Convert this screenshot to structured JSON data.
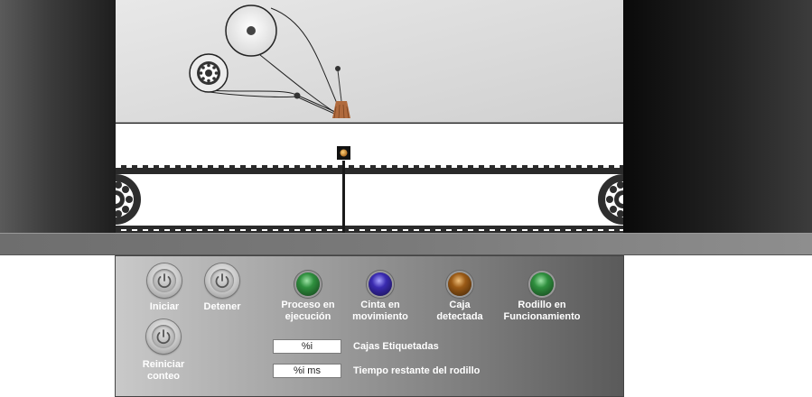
{
  "controls": {
    "start_label": "Iniciar",
    "stop_label": "Detener",
    "reset_label_line1": "Reiniciar",
    "reset_label_line2": "conteo"
  },
  "indicators": [
    {
      "line1": "Proceso en",
      "line2": "ejecución",
      "color": "#1f6b2c"
    },
    {
      "line1": "Cinta en",
      "line2": "movimiento",
      "color": "#2a1c86"
    },
    {
      "line1": "Caja",
      "line2": "detectada",
      "color": "#7a4a12"
    },
    {
      "line1": "Rodillo en",
      "line2": "Funcionamiento",
      "color": "#1f6b2c"
    }
  ],
  "counters": {
    "boxes_value": "%i",
    "boxes_label": "Cajas Etiquetadas",
    "roller_value": "%i ms",
    "roller_label": "Tiempo restante del rodillo"
  }
}
